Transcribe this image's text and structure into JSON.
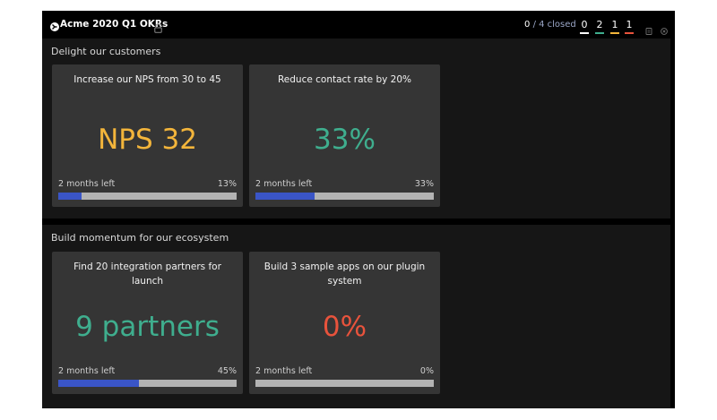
{
  "header": {
    "app_title": "Acme 2020 Q1 OKRs",
    "closed_count": "0",
    "closed_total": "/ 4 closed",
    "stats": [
      {
        "value": "0",
        "color": "#ffffff"
      },
      {
        "value": "2",
        "color": "#3fae8e"
      },
      {
        "value": "1",
        "color": "#f3b53b"
      },
      {
        "value": "1",
        "color": "#e8533c"
      }
    ]
  },
  "objectives": [
    {
      "title": "Delight our customers",
      "key_results": [
        {
          "title": "Increase our NPS from 30 to 45",
          "metric": "NPS 32",
          "metric_color": "#f3b53b",
          "time_left": "2 months left",
          "progress_label": "13%",
          "progress": 0.13
        },
        {
          "title": "Reduce contact rate by 20%",
          "metric": "33%",
          "metric_color": "#3fae8e",
          "time_left": "2 months left",
          "progress_label": "33%",
          "progress": 0.33
        }
      ]
    },
    {
      "title": "Build momentum for our ecosystem",
      "key_results": [
        {
          "title": "Find 20 integration partners for launch",
          "metric": "9 partners",
          "metric_color": "#3fae8e",
          "time_left": "2 months left",
          "progress_label": "45%",
          "progress": 0.45
        },
        {
          "title": "Build 3 sample apps on our plugin system",
          "metric": "0%",
          "metric_color": "#e8533c",
          "time_left": "2 months left",
          "progress_label": "0%",
          "progress": 0.0
        }
      ]
    }
  ]
}
